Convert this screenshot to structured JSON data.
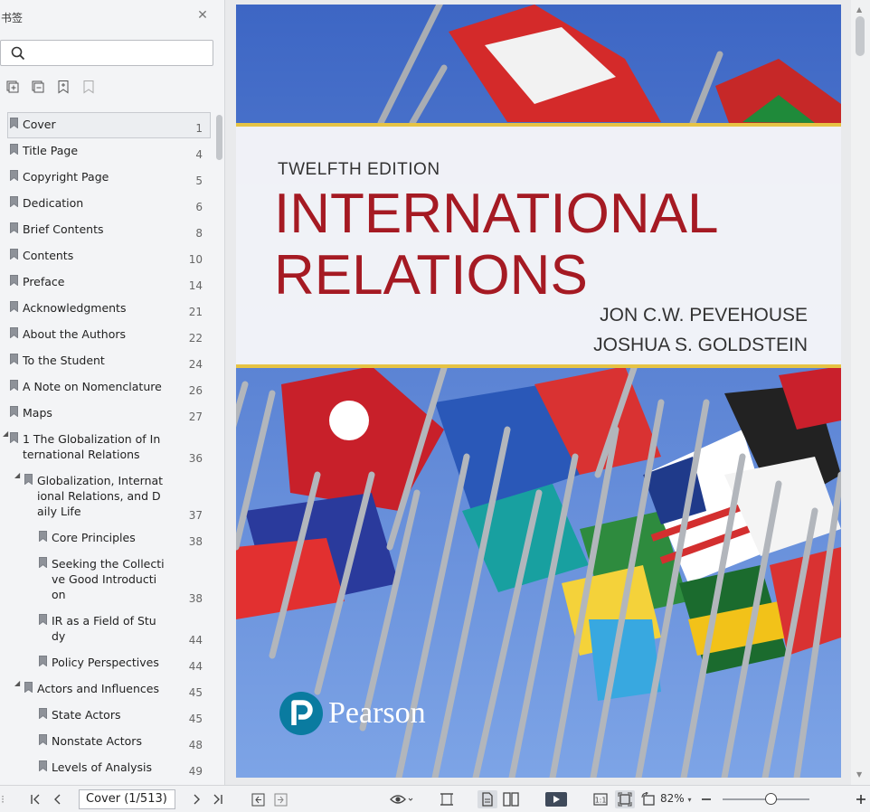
{
  "sidebar": {
    "title": "书签",
    "search_placeholder": "",
    "tools": [
      "expand-all-icon",
      "collapse-all-icon",
      "add-bookmark-icon",
      "bookmark-outline-icon"
    ],
    "bookmarks": [
      {
        "label": [
          "Cover"
        ],
        "page": "1",
        "level": 0,
        "expander": "",
        "selected": true
      },
      {
        "label": [
          "Title Page"
        ],
        "page": "4",
        "level": 0,
        "expander": ""
      },
      {
        "label": [
          "Copyright Page"
        ],
        "page": "5",
        "level": 0,
        "expander": ""
      },
      {
        "label": [
          "Dedication"
        ],
        "page": "6",
        "level": 0,
        "expander": ""
      },
      {
        "label": [
          "Brief Contents"
        ],
        "page": "8",
        "level": 0,
        "expander": ""
      },
      {
        "label": [
          "Contents"
        ],
        "page": "10",
        "level": 0,
        "expander": ""
      },
      {
        "label": [
          "Preface"
        ],
        "page": "14",
        "level": 0,
        "expander": ""
      },
      {
        "label": [
          "Acknowledgments"
        ],
        "page": "21",
        "level": 0,
        "expander": ""
      },
      {
        "label": [
          "About the Authors"
        ],
        "page": "22",
        "level": 0,
        "expander": ""
      },
      {
        "label": [
          "To the Student"
        ],
        "page": "24",
        "level": 0,
        "expander": ""
      },
      {
        "label": [
          "A Note on Nomenclature"
        ],
        "page": "26",
        "level": 0,
        "expander": ""
      },
      {
        "label": [
          "Maps"
        ],
        "page": "27",
        "level": 0,
        "expander": ""
      },
      {
        "label": [
          "1 The Globalization of In",
          "ternational Relations"
        ],
        "page": "36",
        "level": 0,
        "expander": "expanded"
      },
      {
        "label": [
          "Globalization, Internat",
          "ional Relations, and D",
          "aily Life"
        ],
        "page": "37",
        "level": 1,
        "expander": "expanded"
      },
      {
        "label": [
          "Core Principles"
        ],
        "page": "38",
        "level": 2,
        "expander": ""
      },
      {
        "label": [
          "Seeking the Collecti",
          "ve Good Introducti",
          "on"
        ],
        "page": "38",
        "level": 2,
        "expander": ""
      },
      {
        "label": [
          "IR as a Field of Stu",
          "dy"
        ],
        "page": "44",
        "level": 2,
        "expander": ""
      },
      {
        "label": [
          "Policy Perspectives"
        ],
        "page": "44",
        "level": 2,
        "expander": ""
      },
      {
        "label": [
          "Actors and Influences"
        ],
        "page": "45",
        "level": 1,
        "expander": "expanded"
      },
      {
        "label": [
          "State Actors"
        ],
        "page": "45",
        "level": 2,
        "expander": ""
      },
      {
        "label": [
          "Nonstate Actors"
        ],
        "page": "48",
        "level": 2,
        "expander": ""
      },
      {
        "label": [
          "Levels of Analysis"
        ],
        "page": "49",
        "level": 2,
        "expander": ""
      }
    ]
  },
  "cover": {
    "edition": "TWELFTH EDITION",
    "title_line1": "INTERNATIONAL",
    "title_line2": "RELATIONS",
    "author1": "JON C.W. PEVEHOUSE",
    "author2": "JOSHUA S. GOLDSTEIN",
    "publisher": "Pearson",
    "colors": {
      "title": "#a51a23",
      "band_rule": "#e6c344",
      "sky": "#4a6fc9"
    }
  },
  "toolbar": {
    "page_field": "Cover (1/513)",
    "zoom": "82%",
    "zoom_level": 0.55,
    "icons": [
      "first-page-icon",
      "prev-page-icon",
      "next-page-icon",
      "last-page-icon",
      "back-icon",
      "forward-icon",
      "eye-icon",
      "fit-width-icon",
      "single-page-icon",
      "two-page-icon",
      "play-icon",
      "actual-size-icon",
      "fit-page-icon",
      "rotate-icon",
      "zoom-out-icon",
      "zoom-in-icon"
    ]
  }
}
